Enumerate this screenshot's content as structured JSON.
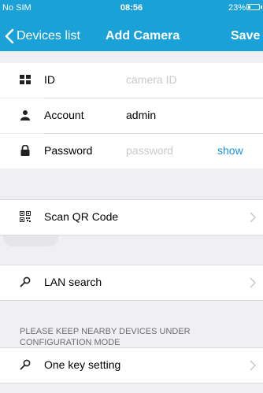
{
  "status_bar": {
    "carrier": "No SIM",
    "time": "08:56",
    "battery_percent": "23%",
    "battery_level": 0.23
  },
  "nav": {
    "back_label": "Devices list",
    "title": "Add Camera",
    "save_label": "Save"
  },
  "form": {
    "id": {
      "label": "ID",
      "placeholder": "camera ID",
      "icon": "grid-icon"
    },
    "account": {
      "label": "Account",
      "value": "admin",
      "icon": "person-icon"
    },
    "password": {
      "label": "Password",
      "placeholder": "password",
      "show_label": "show",
      "icon": "lock-icon"
    }
  },
  "actions": {
    "scan_qr": {
      "label": "Scan QR Code",
      "icon": "qr-code-icon"
    },
    "lan_search": {
      "label": "LAN search",
      "icon": "search-icon"
    },
    "one_key": {
      "label": "One key setting",
      "icon": "search-icon"
    }
  },
  "notes": {
    "configuration": "PLEASE KEEP NEARBY DEVICES UNDER CONFIGURATION MODE"
  },
  "colors": {
    "header": "#1aa1d8",
    "link": "#1a8fdf",
    "background": "#efeff4"
  }
}
